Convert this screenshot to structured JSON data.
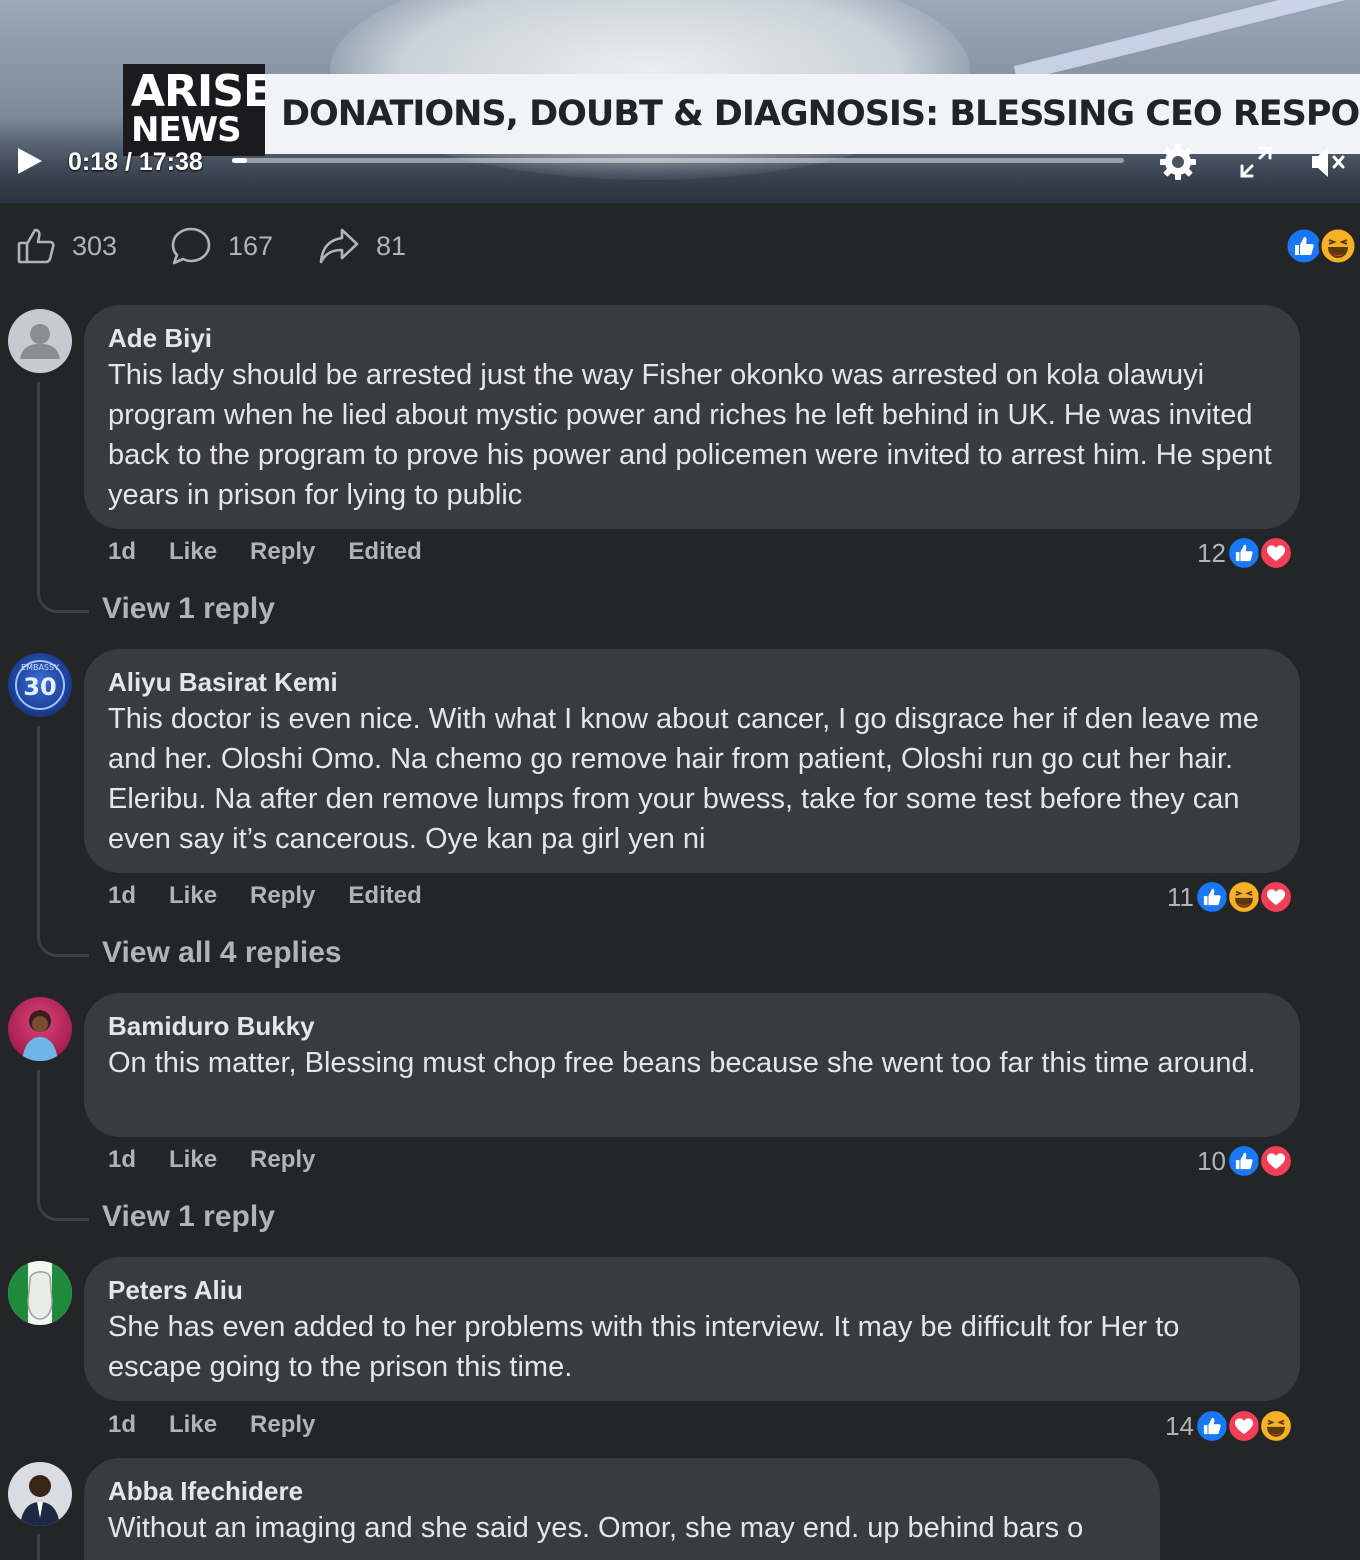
{
  "video": {
    "logo_line1": "ARISE",
    "logo_line2": "NEWS",
    "headline": "DONATIONS, DOUBT & DIAGNOSIS: BLESSING CEO RESPONDS",
    "time": "0:18 / 17:38",
    "progress": 0.017
  },
  "stats": {
    "likes": "303",
    "comments": "167",
    "shares": "81"
  },
  "comments": [
    {
      "author": "Ade Biyi",
      "text": "This lady should be arrested just the way Fisher okonko was arrested on kola olawuyi program when he lied about mystic power and riches he left behind in UK. He was invited back to the program to prove his power and policemen were invited to arrest him. He spent years in prison for lying to public",
      "time": "1d",
      "like": "Like",
      "reply": "Reply",
      "edited": "Edited",
      "reaction_count": "12",
      "reactions": [
        "like",
        "love"
      ],
      "view_replies": "View 1 reply"
    },
    {
      "author": "Aliyu Basirat Kemi",
      "text": "This doctor is even nice. With what I know about cancer, I go disgrace her if den leave me and her. Oloshi Omo. Na chemo go remove hair from patient, Oloshi run go cut her hair. Eleribu. Na after den remove lumps from your bwess, take for some test before they can even say it’s cancerous. Oye kan pa girl yen ni",
      "time": "1d",
      "like": "Like",
      "reply": "Reply",
      "edited": "Edited",
      "reaction_count": "11",
      "reactions": [
        "like",
        "haha",
        "love"
      ],
      "view_replies": "View all 4 replies",
      "avatar_text": "30",
      "avatar_badge": "EMBASSY"
    },
    {
      "author": "Bamiduro Bukky",
      "text": "On this matter, Blessing must chop free beans because she went too far this time around.",
      "time": "1d",
      "like": "Like",
      "reply": "Reply",
      "reaction_count": "10",
      "reactions": [
        "like",
        "love"
      ],
      "view_replies": "View 1 reply"
    },
    {
      "author": "Peters Aliu",
      "text": "She has even added to her problems with this interview. It may be difficult for Her to escape going to the prison this time.",
      "time": "1d",
      "like": "Like",
      "reply": "Reply",
      "reaction_count": "14",
      "reactions": [
        "like",
        "love",
        "haha"
      ]
    },
    {
      "author": "Abba Ifechidere",
      "text": "Without an imaging and she said yes. Omor, she may end. up behind bars o"
    }
  ],
  "colors": {
    "like": "#1877f2",
    "love": "#f33e58",
    "haha": "#f7b125",
    "bubble": "#3a3b3c",
    "background": "#242526"
  }
}
